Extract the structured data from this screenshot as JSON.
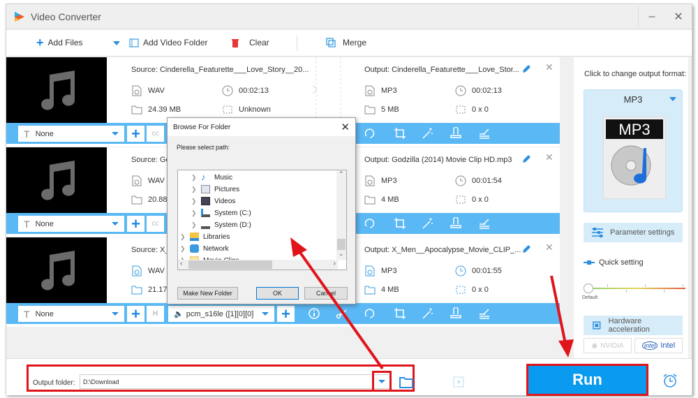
{
  "app": {
    "title": "Video Converter",
    "minimize_icon": "minimize-icon",
    "close_icon": "close-icon"
  },
  "toolbar": {
    "add_files": "Add Files",
    "add_video_folder": "Add Video Folder",
    "clear": "Clear",
    "merge": "Merge"
  },
  "files": [
    {
      "source": "Source: Cinderella_Featurette___Love_Story__20...",
      "src_format": "WAV",
      "src_duration": "00:02:13",
      "src_size": "24.39 MB",
      "src_resolution": "Unknown",
      "output": "Output: Cinderella_Featurette___Love_Stor...",
      "out_format": "MP3",
      "out_duration": "00:02:13",
      "out_size": "5 MB",
      "out_resolution": "0 x 0",
      "subtitle": "None"
    },
    {
      "source": "Source: Go",
      "src_format": "WAV",
      "src_size": "20.88",
      "output": "Output: Godzilla  (2014) Movie Clip HD.mp3",
      "out_format": "MP3",
      "out_duration": "00:01:54",
      "out_size": "4 MB",
      "out_resolution": "0 x 0",
      "subtitle": "None"
    },
    {
      "source": "Source: X_",
      "src_format": "WAV",
      "src_size": "21.17",
      "output": "Output: X_Men__Apocalypse_Movie_CLIP_...",
      "out_format": "MP3",
      "out_duration": "00:01:55",
      "out_size": "4 MB",
      "out_resolution": "0 x 0",
      "subtitle": "None",
      "audio_track": "pcm_s16le ([1][0][0]"
    }
  ],
  "right_panel": {
    "change_format_label": "Click to change output format:",
    "format": "MP3",
    "format_icon_text": "MP3",
    "parameter_settings": "Parameter settings",
    "quick_setting": "Quick setting",
    "quality_level": 0,
    "slider_label": "Default",
    "hardware_acceleration": "Hardware acceleration",
    "nvidia": "NVIDIA",
    "intel": "Intel"
  },
  "footer": {
    "output_folder_label": "Output folder:",
    "output_folder_value": "D:\\Download",
    "run": "Run"
  },
  "dialog": {
    "title": "Browse For Folder",
    "prompt": "Please select path:",
    "tree": [
      {
        "label": "Music",
        "level": 1
      },
      {
        "label": "Pictures",
        "level": 1
      },
      {
        "label": "Videos",
        "level": 1
      },
      {
        "label": "System (C:)",
        "level": 1
      },
      {
        "label": "System (D:)",
        "level": 1
      },
      {
        "label": "Libraries",
        "level": 0
      },
      {
        "label": "Network",
        "level": 0
      },
      {
        "label": "Movie Clips",
        "level": 0
      }
    ],
    "make_new_folder": "Make New Folder",
    "ok": "OK",
    "cancel": "Cancel"
  },
  "colors": {
    "accent": "#5ab8f5",
    "run": "#0a9bf0",
    "highlight": "#e0151b"
  }
}
